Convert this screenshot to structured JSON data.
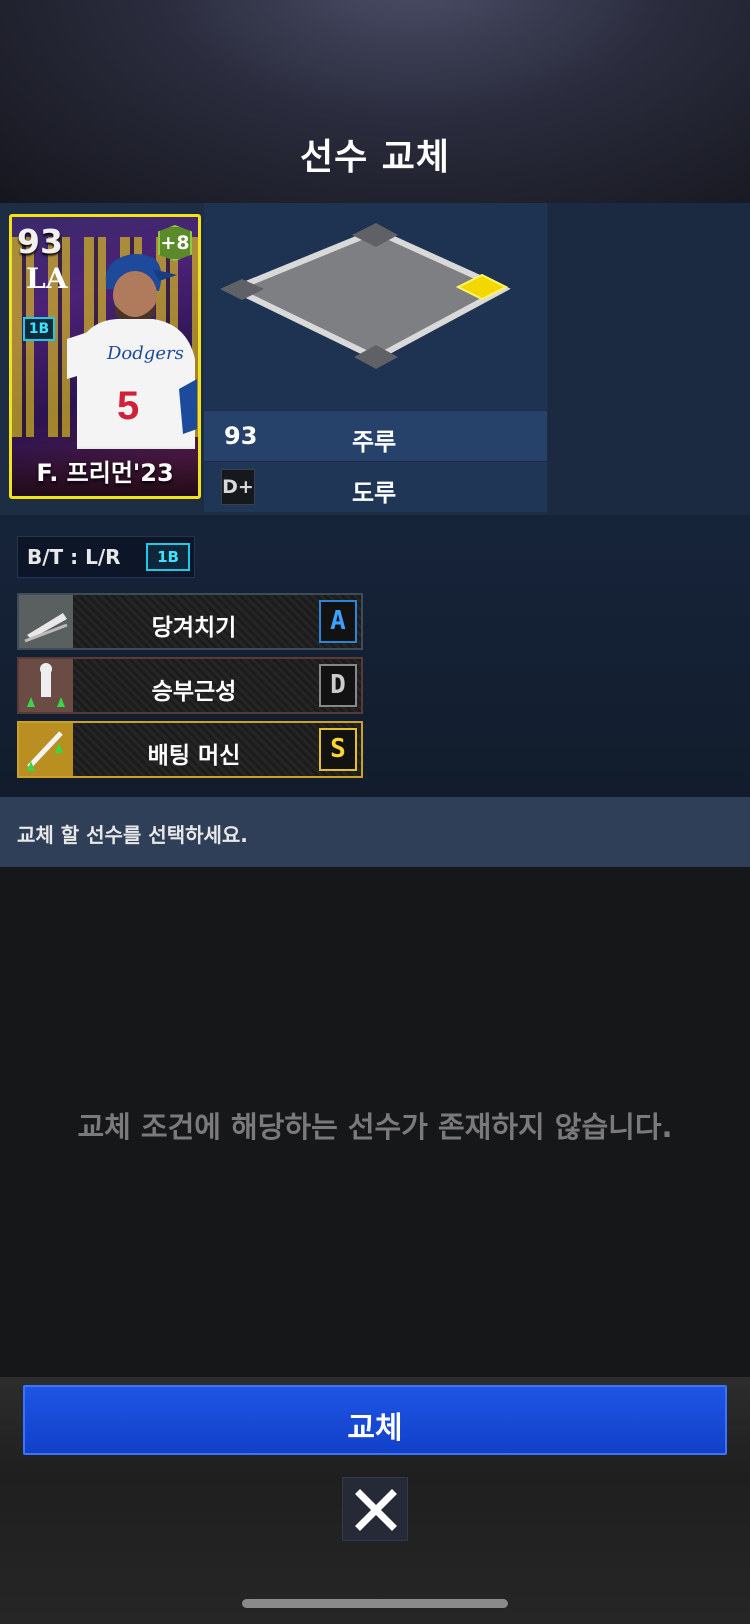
{
  "header": {
    "title": "선수 교체"
  },
  "card": {
    "ovr": "93",
    "plus": "+8",
    "team_logo": "LA",
    "position": "1B",
    "jersey_number": "5",
    "jersey_text": "Dodgers",
    "name": "F. 프리먼'23"
  },
  "stats": [
    {
      "value": "93",
      "label": "주루"
    },
    {
      "value": "D+",
      "label": "도루"
    }
  ],
  "bat_throw": {
    "text": "B/T : L/R",
    "position": "1B"
  },
  "skills": [
    {
      "name": "당겨치기",
      "grade": "A",
      "icon": "pull-hitting-icon"
    },
    {
      "name": "승부근성",
      "grade": "D",
      "icon": "competitive-spirit-icon"
    },
    {
      "name": "배팅 머신",
      "grade": "S",
      "icon": "batting-machine-icon"
    }
  ],
  "message": "교체 할 선수를 선택하세요.",
  "empty_text": "교체 조건에 해당하는 선수가 존재하지 않습니다.",
  "buttons": {
    "replace": "교체",
    "close_icon": "close-icon"
  },
  "colors": {
    "accent_blue": "#1f55e6",
    "card_border": "#f2e21a",
    "selected_base": "#f2d700"
  }
}
